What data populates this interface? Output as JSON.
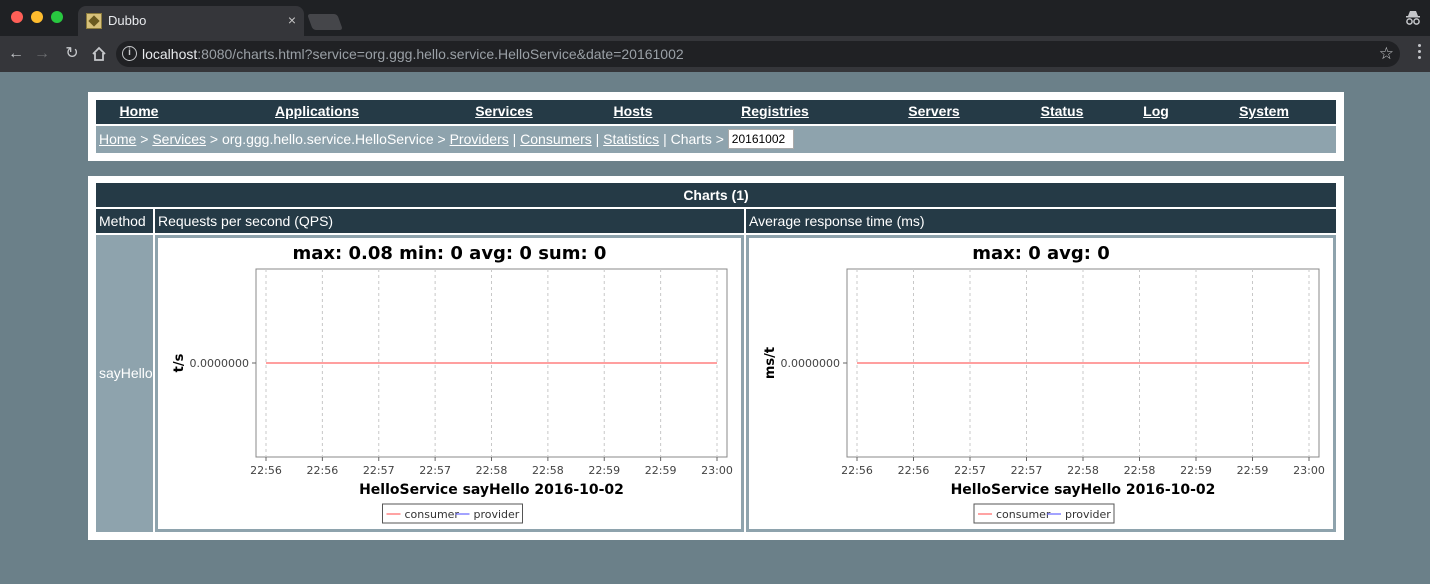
{
  "browser": {
    "tab_title": "Dubbo",
    "tab_close": "×",
    "url_host": "localhost",
    "url_rest": ":8080/charts.html?service=org.ggg.hello.service.HelloService&date=20161002"
  },
  "menu": [
    "Home",
    "Applications",
    "Services",
    "Hosts",
    "Registries",
    "Servers",
    "Status",
    "Log",
    "System"
  ],
  "breadcrumb": {
    "home": "Home",
    "sep1": " > ",
    "services": "Services",
    "sep2": " > org.ggg.hello.service.HelloService > ",
    "providers": "Providers",
    "sep3": " | ",
    "consumers": "Consumers",
    "sep4": " | ",
    "statistics": "Statistics",
    "sep5": " | Charts > ",
    "date_value": "20161002"
  },
  "table": {
    "title": "Charts (1)",
    "col_method": "Method",
    "col_qps": "Requests per second (QPS)",
    "col_art": "Average response time (ms)",
    "method": "sayHello"
  },
  "chart_data": [
    {
      "type": "line",
      "title": "max: 0.08 min: 0 avg: 0 sum: 0",
      "ylabel": "t/s",
      "xlabel": "HelloService  sayHello  2016-10-02",
      "y_tick": "0.0000000",
      "x_ticks": [
        "22:56",
        "22:56",
        "22:57",
        "22:57",
        "22:58",
        "22:58",
        "22:59",
        "22:59",
        "23:00"
      ],
      "legend": [
        "consumer",
        "provider"
      ],
      "series": [
        {
          "name": "consumer",
          "color": "#ff6666",
          "values": [
            0,
            0,
            0,
            0,
            0,
            0,
            0,
            0,
            0
          ]
        },
        {
          "name": "provider",
          "color": "#6666ff",
          "values": []
        }
      ],
      "grid": true
    },
    {
      "type": "line",
      "title": "max: 0 avg: 0",
      "ylabel": "ms/t",
      "xlabel": "HelloService  sayHello  2016-10-02",
      "y_tick": "0.0000000",
      "x_ticks": [
        "22:56",
        "22:56",
        "22:57",
        "22:57",
        "22:58",
        "22:58",
        "22:59",
        "22:59",
        "23:00"
      ],
      "legend": [
        "consumer",
        "provider"
      ],
      "series": [
        {
          "name": "consumer",
          "color": "#ff6666",
          "values": [
            0,
            0,
            0,
            0,
            0,
            0,
            0,
            0,
            0
          ]
        },
        {
          "name": "provider",
          "color": "#6666ff",
          "values": []
        }
      ],
      "grid": true
    }
  ],
  "colors": {
    "page_bg": "#6b8089",
    "header_bg": "#253a46",
    "cell_bg": "#8ea3ad"
  }
}
